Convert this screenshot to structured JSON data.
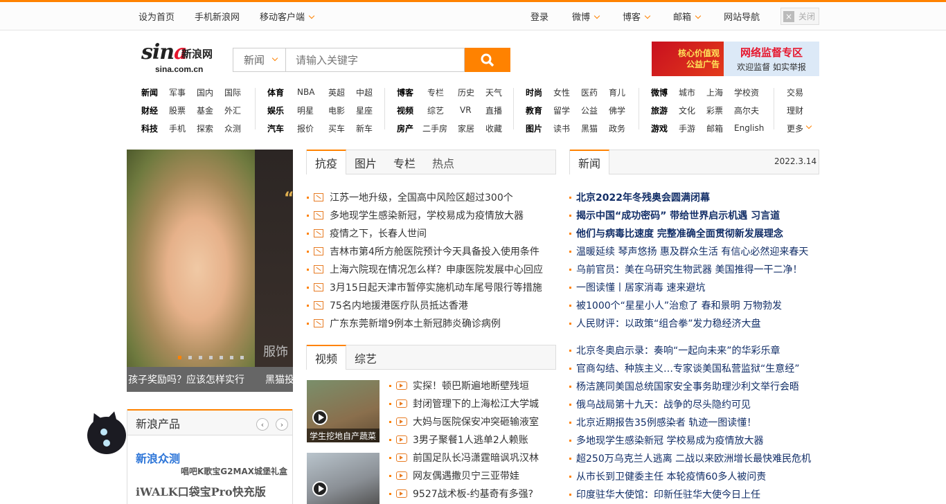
{
  "topbar": {
    "left": [
      "设为首页",
      "手机新浪网",
      "移动客户端"
    ],
    "right": [
      "登录",
      "微博",
      "博客",
      "邮箱",
      "网站导航"
    ],
    "close_label": "关闭",
    "close_x": "×"
  },
  "logo": {
    "brand_prefix": "sin",
    "brand_a": "a",
    "brand_cn": "新浪网",
    "domain": "sina.com.cn"
  },
  "search": {
    "category": "新闻",
    "placeholder": "请输入关键字"
  },
  "ad": {
    "left_line1": "核心价值观",
    "left_line2": "公益广告",
    "title": "网络监督专区",
    "subtitle": "欢迎监督 如实举报"
  },
  "nav": {
    "col1": [
      [
        "新闻",
        "军事",
        "国内",
        "国际"
      ],
      [
        "财经",
        "股票",
        "基金",
        "外汇"
      ],
      [
        "科技",
        "手机",
        "探索",
        "众测"
      ]
    ],
    "col2": [
      [
        "体育",
        "NBA",
        "英超",
        "中超"
      ],
      [
        "娱乐",
        "明星",
        "电影",
        "星座"
      ],
      [
        "汽车",
        "报价",
        "买车",
        "新车"
      ]
    ],
    "col3": [
      [
        "博客",
        "专栏",
        "历史",
        "天气"
      ],
      [
        "视频",
        "综艺",
        "VR",
        "直播"
      ],
      [
        "房产",
        "二手房",
        "家居",
        "收藏"
      ]
    ],
    "col4": [
      [
        "时尚",
        "女性",
        "医药",
        "育儿"
      ],
      [
        "教育",
        "留学",
        "公益",
        "佛学"
      ],
      [
        "图片",
        "读书",
        "黑猫",
        "政务"
      ]
    ],
    "col5": [
      [
        "微博",
        "城市",
        "上海",
        "学校资"
      ],
      [
        "旅游",
        "文化",
        "彩票",
        "高尔夫"
      ],
      [
        "游戏",
        "手游",
        "邮箱",
        "English"
      ]
    ],
    "col6": [
      "交易",
      "理财",
      "更多"
    ]
  },
  "slider": {
    "caption_a": "孩子奖励吗？应该怎样实行",
    "caption_b": "黑猫投",
    "slide_text": "服饰"
  },
  "tabs1": [
    "抗疫",
    "图片",
    "专栏",
    "热点"
  ],
  "covid_news": [
    "江苏一地升级，全国高中风险区超过300个",
    "多地现学生感染新冠，学校易成为疫情放大器",
    "疫情之下，长春人世间",
    "吉林市第4所方舱医院预计今天具备投入使用条件",
    "上海六院现在情况怎么样？申康医院发展中心回应",
    "3月15日起天津市暂停实施机动车尾号限行等措施",
    "75名内地援港医疗队员抵达香港",
    "广东东莞新增9例本土新冠肺炎确诊病例"
  ],
  "tabs2": [
    "视频",
    "综艺"
  ],
  "video_thumbs": [
    "学生挖地自产蔬菜",
    ""
  ],
  "video_list": [
    "实探！顿巴斯遍地断壁残垣",
    "封闭管理下的上海松江大学城",
    "大妈与医院保安冲突砸输液室",
    "3男子聚餐1人逃单2人赖账",
    "前国足队长冯潇霆暗讽巩汉林",
    "网友偶遇撒贝宁三亚带娃",
    "9527战术板-约基奇有多强?"
  ],
  "news_tab": "新闻",
  "news_date": "2022.3.14",
  "top_news": [
    "北京2022年冬残奥会圆满闭幕",
    "揭示中国“成功密码” 带给世界启示机遇 习言道",
    "他们与病毒比速度 完整准确全面贯彻新发展理念"
  ],
  "news1": [
    "温暖延续 琴声悠扬 惠及群众生活 有信心必然迎来春天",
    "乌前官员：美在乌研究生物武器 美国推得一干二净！",
    "一图读懂丨居家消毒 速来避坑",
    "被1000个“星星小人”治愈了 春和景明 万物勃发",
    "人民财评：以政策“组合拳”发力稳经济大盘"
  ],
  "news2": [
    "北京冬奥启示录：奏响“一起向未来”的华彩乐章",
    "官商勾结、种族主义…专家谈美国私营监狱“生意经”",
    "杨洁篪同美国总统国家安全事务助理沙利文举行会晤",
    "俄乌战局第十九天：战争的尽头隐约可见",
    "北京近期报告35例感染者 轨迹一图读懂！",
    "多地现学生感染新冠 学校易成为疫情放大器",
    "超250万乌克兰人逃离 二战以来欧洲增长最快难民危机",
    "从市长到卫健委主任 本轮疫情60多人被问责",
    "印度驻华大使馆：印新任驻华大使今日上任"
  ],
  "products": {
    "title": "新浪产品",
    "arrow_prev": "‹",
    "arrow_next": "›",
    "item1": "新浪众测",
    "item1_sub": "唱吧K歌宝G2MAX城堡礼盒",
    "item2": "iWALK口袋宝Pro快充版"
  }
}
